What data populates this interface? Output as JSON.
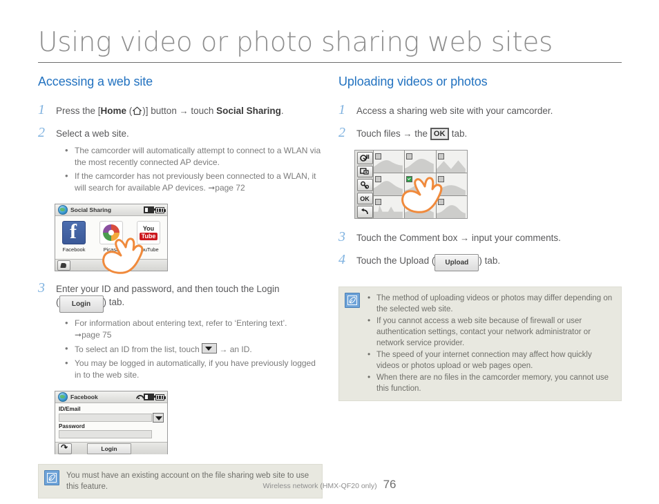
{
  "page": {
    "title": "Using video or photo sharing web sites",
    "footer_text": "Wireless network (HMX-QF20 only)",
    "page_number": "76",
    "accent_blue": "#2272c0",
    "step_num_color": "#7fb2e0",
    "note_bg": "#e8e8e0"
  },
  "left": {
    "heading": "Accessing a web site",
    "step1": {
      "num": "1",
      "pre": "Press the [",
      "bold1": "Home",
      "mid": " (",
      "icon": "home-icon",
      "post1": ")] button ",
      "arrow": "→",
      "post2": " touch ",
      "bold2": "Social Sharing",
      "end": "."
    },
    "step2": {
      "num": "2",
      "text": "Select a web site.",
      "bullets": [
        "The camcorder will automatically attempt to connect to a WLAN via the most recently connected AP device.",
        "If the camcorder has not previously been connected to a WLAN, it will search for available AP devices."
      ],
      "bullet2_page_ref": "page 72"
    },
    "social_mock": {
      "title": "Social Sharing",
      "apps": [
        {
          "label": "Facebook",
          "icon": "facebook-icon"
        },
        {
          "label": "Picasa",
          "icon": "picasa-icon"
        },
        {
          "label": "YouTube",
          "icon": "youtube-icon"
        }
      ],
      "foot_icon": "network-icon"
    },
    "step3": {
      "num": "3",
      "line1": "Enter your ID and password, and then touch the Login",
      "paren_open": "(",
      "button_label": "Login",
      "paren_close": ") tab.",
      "bullets": [
        {
          "text": "For information about entering text, refer to ‘Entering text’.",
          "page_ref": "page 75"
        },
        {
          "pre": "To select an ID from the list, touch ",
          "glyph": "dropdown-icon",
          "post": " → an ID."
        },
        {
          "text": "You may be logged in automatically, if you have previously logged in to the web site."
        }
      ]
    },
    "fb_mock": {
      "title": "Facebook",
      "id_label": "ID/Email",
      "id_value": "",
      "password_label": "Password",
      "password_value": "",
      "login_label": "Login",
      "back_icon": "back-arrow-icon",
      "dropdown_icon": "chevron-down-icon"
    },
    "note": {
      "icon": "note-pencil-icon",
      "text": "You must have an existing account on the file sharing web site to use this feature."
    }
  },
  "right": {
    "heading": "Uploading videos or photos",
    "step1": {
      "num": "1",
      "text": "Access a sharing web site with your camcorder."
    },
    "step2": {
      "num": "2",
      "pre": "Touch files ",
      "arrow": "→",
      "mid": " the ",
      "tab_label": "OK",
      "post": " tab."
    },
    "grid_mock": {
      "side_buttons": [
        {
          "name": "video-mode-icon",
          "label": ""
        },
        {
          "name": "photo-mode-icon",
          "label": ""
        },
        {
          "name": "settings-icon",
          "label": ""
        },
        {
          "name": "ok-button",
          "label": "OK"
        },
        {
          "name": "back-arrow-icon",
          "label": ""
        }
      ],
      "checked_index": 4
    },
    "step3": {
      "num": "3",
      "pre": "Touch the Comment box ",
      "arrow": "→",
      "post": " input your comments."
    },
    "step4": {
      "num": "4",
      "pre": "Touch the Upload (",
      "button_label": "Upload",
      "post": ") tab."
    },
    "note": {
      "icon": "note-pencil-icon",
      "bullets": [
        "The method of uploading videos or photos may differ depending on the selected web site.",
        "If you cannot access a web site because of firewall or user authentication settings, contact your network administrator or network service provider.",
        "The speed of your internet connection may affect how quickly videos or photos upload or web pages open.",
        "When there are no files in the camcorder memory, you cannot use this function."
      ]
    }
  }
}
